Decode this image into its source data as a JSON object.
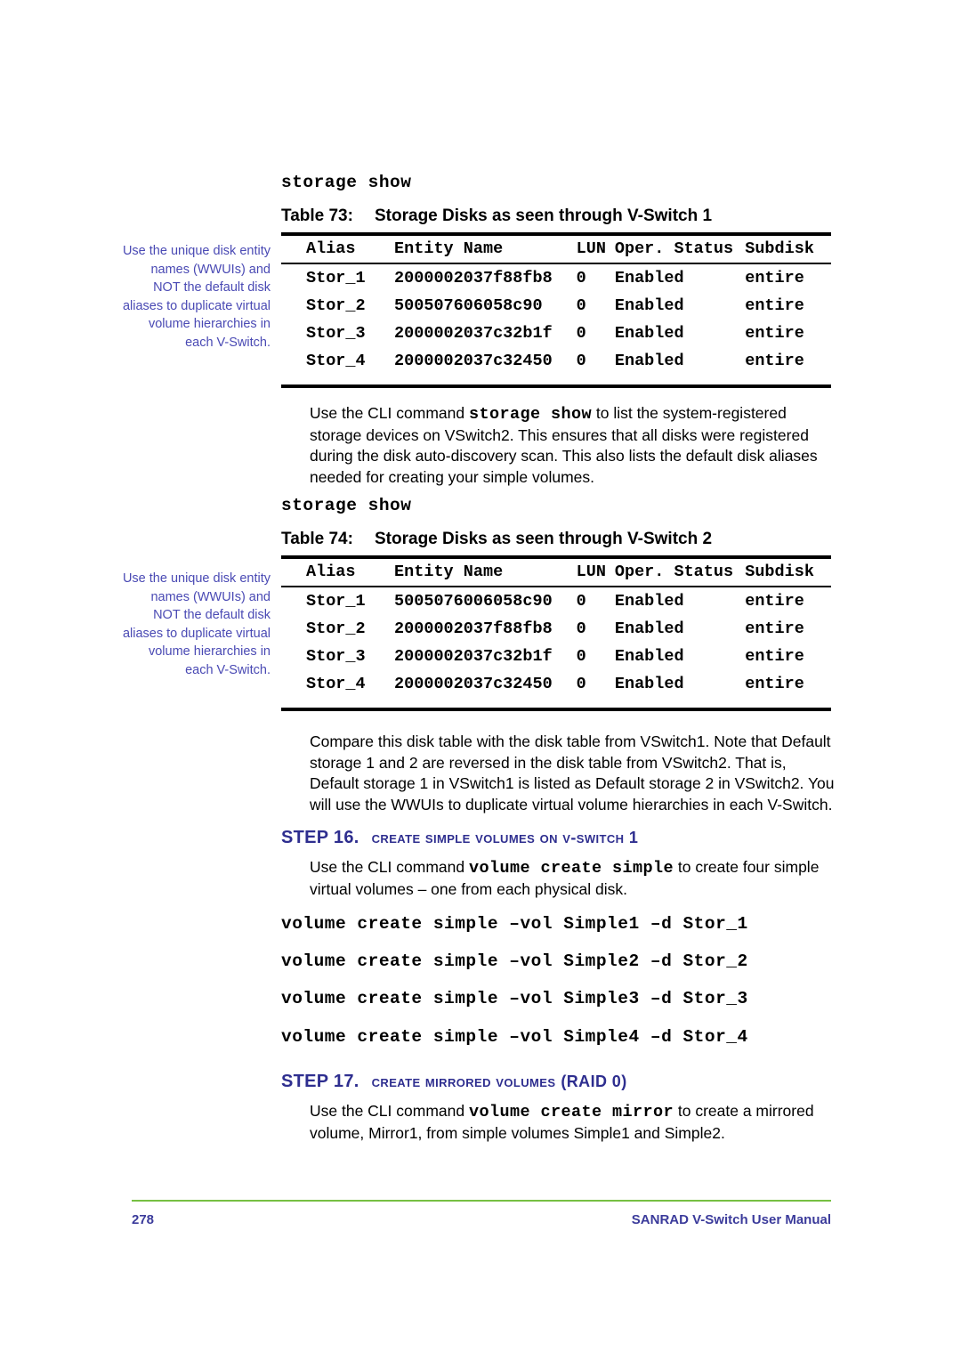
{
  "document": {
    "footer_page_number": "278",
    "footer_title": "SANRAD V-Switch User Manual"
  },
  "margin_note": "Use the unique disk entity names (WWUIs) and NOT the default disk aliases to duplicate virtual volume hierarchies in each V-Switch.",
  "cli_commands": {
    "storage_show_1": "storage show",
    "storage_show_2": "storage show",
    "volume_create_1": "volume create simple –vol Simple1 –d Stor_1",
    "volume_create_2": "volume create simple –vol Simple2 –d Stor_2",
    "volume_create_3": "volume create simple –vol Simple3 –d Stor_3",
    "volume_create_4": "volume create simple –vol Simple4 –d Stor_4"
  },
  "table_73": {
    "caption_label": "Table 73:",
    "caption_text": "Storage Disks as seen through V-Switch 1",
    "columns": [
      "Alias",
      "Entity Name",
      "LUN",
      "Oper. Status",
      "Subdisk"
    ],
    "rows": [
      [
        "Stor_1",
        "2000002037f88fb8",
        "0",
        "Enabled",
        "entire"
      ],
      [
        "Stor_2",
        "500507606058c90",
        "0",
        "Enabled",
        "entire"
      ],
      [
        "Stor_3",
        "2000002037c32b1f",
        "0",
        "Enabled",
        "entire"
      ],
      [
        "Stor_4",
        "2000002037c32450",
        "0",
        "Enabled",
        "entire"
      ]
    ]
  },
  "table_74": {
    "caption_label": "Table 74:",
    "caption_text": "Storage Disks as seen through V-Switch 2",
    "columns": [
      "Alias",
      "Entity Name",
      "LUN",
      "Oper. Status",
      "Subdisk"
    ],
    "rows": [
      [
        "Stor_1",
        "5005076006058c90",
        "0",
        "Enabled",
        "entire"
      ],
      [
        "Stor_2",
        "2000002037f88fb8",
        "0",
        "Enabled",
        "entire"
      ],
      [
        "Stor_3",
        "2000002037c32b1f",
        "0",
        "Enabled",
        "entire"
      ],
      [
        "Stor_4",
        "2000002037c32450",
        "0",
        "Enabled",
        "entire"
      ]
    ]
  },
  "paragraphs": {
    "after_table_73": {
      "part1": "Use the CLI command ",
      "command": "storage show",
      "part2": " to list the system-registered storage devices on VSwitch2.  This ensures that all disks were registered during the disk auto-discovery scan.  This also lists the default disk aliases needed for creating your simple volumes."
    },
    "after_table_74": "Compare this disk table with the disk table from VSwitch1.  Note that Default storage 1 and 2 are reversed in the disk table from VSwitch2.  That is, Default storage 1 in VSwitch1 is listed as Default storage 2 in VSwitch2.  You will use the WWUIs to duplicate virtual volume hierarchies in each V-Switch.",
    "step16_body": {
      "part1": "Use the CLI command ",
      "command": "volume create simple",
      "part2": " to create four simple virtual volumes – one from each physical disk."
    },
    "step17_body": {
      "part1": "Use the CLI command ",
      "command": "volume create mirror",
      "part2": " to create a mirrored volume, Mirror1, from simple volumes Simple1 and Simple2."
    }
  },
  "steps": {
    "step16": {
      "label": "STEP 16.",
      "title": "Create simple volumes on V-Switch 1"
    },
    "step17": {
      "label": "STEP 17.",
      "title": "Create mirrored volumes",
      "title_suffix": "(RAID 0)"
    }
  },
  "colors": {
    "step_heading": "#2e2e8f",
    "margin_note": "#4a4ab4",
    "footer_rule": "#76c043",
    "footer_text": "#3b3b9b"
  }
}
